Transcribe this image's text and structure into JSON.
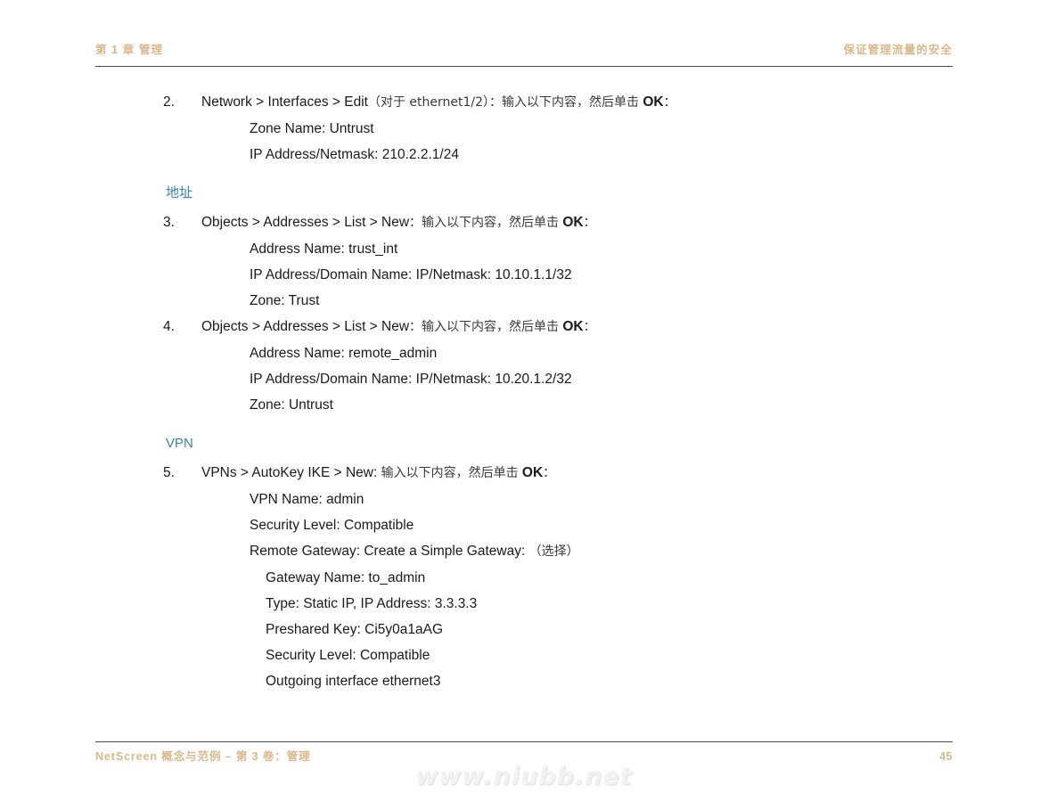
{
  "header": {
    "left": "第 1 章 管理",
    "right": "保证管理流量的安全"
  },
  "footer": {
    "left": "NetScreen 概念与范例 – 第 3 卷：管理",
    "page_number": "45"
  },
  "watermark": "www.niubb.net",
  "colors": {
    "heading_blue": "#3f7fa6",
    "running_text_tan": "#d8b88c",
    "rule": "#4a4a4a",
    "body_text": "#1a1a1a"
  },
  "steps": [
    {
      "number": "2.",
      "lead_path": "Network > Interfaces > Edit",
      "lead_cjk_paren": "（对于 ethernet1/2）：",
      "lead_cjk_tail": "输入以下内容，然后单击",
      "lead_ok": "OK",
      "lead_colon": "：",
      "sublines": [
        "Zone Name: Untrust",
        "IP Address/Netmask: 210.2.2.1/24"
      ]
    },
    {
      "number": "3.",
      "lead_path": "Objects > Addresses > List > New",
      "lead_cjk_paren": "：",
      "lead_cjk_tail": "输入以下内容，然后单击",
      "lead_ok": "OK",
      "lead_colon": "：",
      "sublines": [
        "Address Name: trust_int",
        "IP Address/Domain Name: IP/Netmask: 10.10.1.1/32",
        "Zone: Trust"
      ]
    },
    {
      "number": "4.",
      "lead_path": "Objects > Addresses > List > New",
      "lead_cjk_paren": "：",
      "lead_cjk_tail": "输入以下内容，然后单击",
      "lead_ok": "OK",
      "lead_colon": "：",
      "sublines": [
        "Address Name: remote_admin",
        "IP Address/Domain Name: IP/Netmask: 10.20.1.2/32",
        "Zone: Untrust"
      ]
    },
    {
      "number": "5.",
      "lead_path": "VPNs > AutoKey IKE > New:",
      "lead_cjk_paren": "",
      "lead_cjk_tail": "输入以下内容，然后单击",
      "lead_ok": "OK",
      "lead_colon": "：",
      "sublines": [
        "VPN Name: admin",
        "Security Level: Compatible"
      ],
      "gateway_line": "Remote Gateway: Create a Simple Gateway:",
      "gateway_line_cjk": "（选择）",
      "gateway_sublines": [
        "Gateway Name: to_admin",
        "Type: Static IP, IP Address: 3.3.3.3",
        "Preshared Key: Ci5y0a1aAG",
        "Security Level: Compatible",
        "Outgoing interface ethernet3"
      ]
    }
  ],
  "headings": {
    "address": "地址",
    "vpn": "VPN"
  }
}
